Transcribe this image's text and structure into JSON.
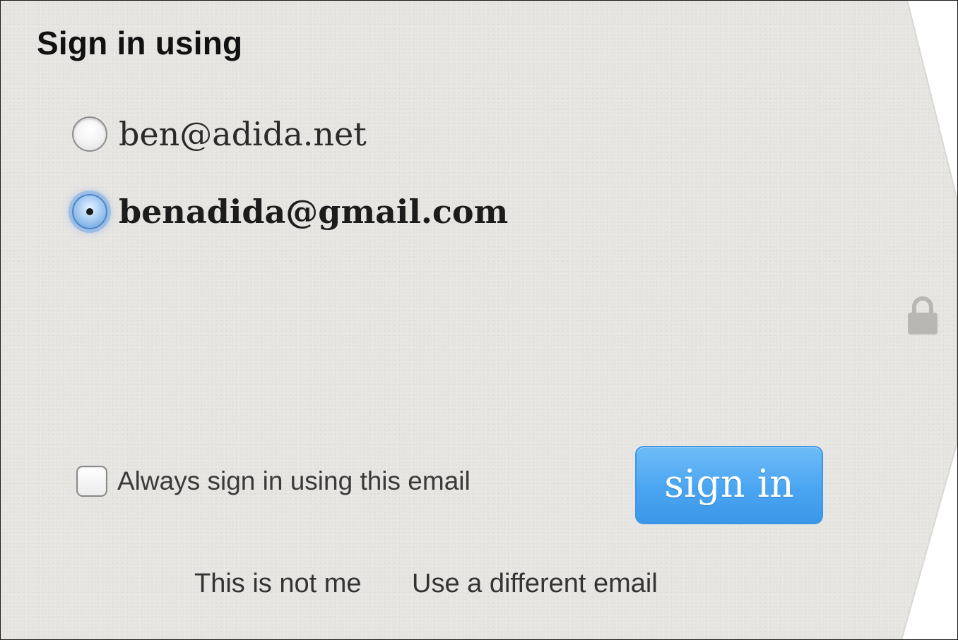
{
  "signin": {
    "heading": "Sign in using",
    "accounts": [
      {
        "email": "ben@adida.net",
        "selected": false
      },
      {
        "email": "benadida@gmail.com",
        "selected": true
      }
    ],
    "remember_label": "Always sign in using this email",
    "remember_checked": false,
    "button_label": "sign in",
    "links": {
      "not_me": "This is not me",
      "different_email": "Use a different email"
    }
  },
  "icons": {
    "lock": "lock-icon"
  },
  "colors": {
    "panel_background": "#e6e4e1",
    "button_blue": "#4aa5f1",
    "radio_focus_blue": "#5a9ad8"
  }
}
